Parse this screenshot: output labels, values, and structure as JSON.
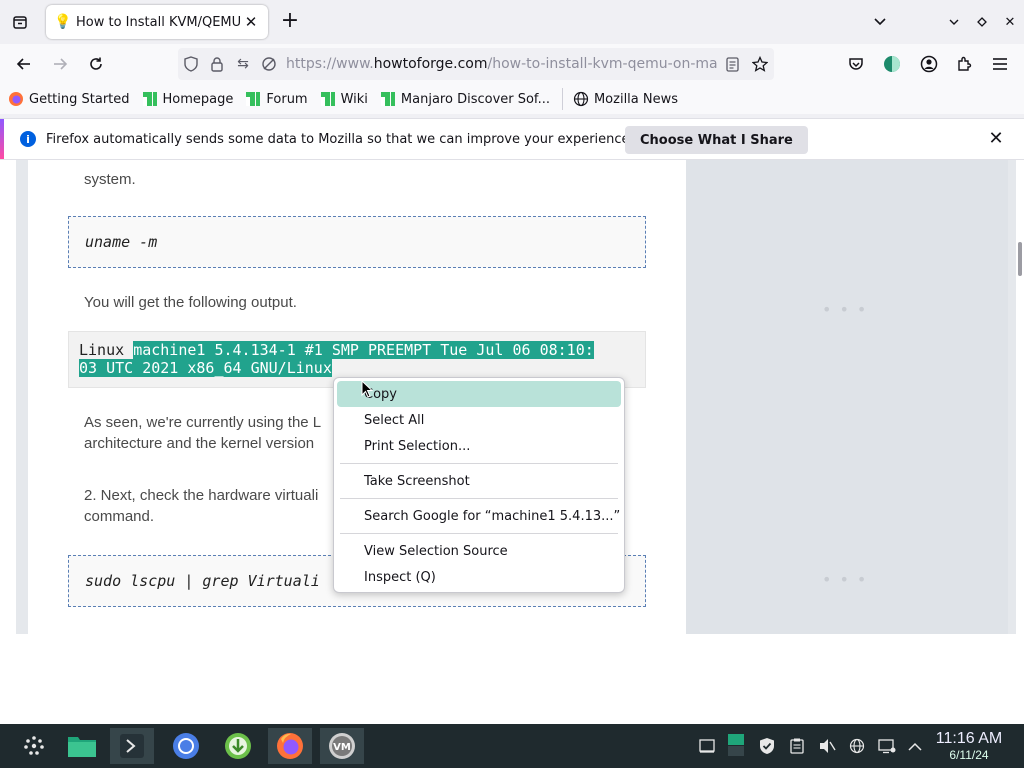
{
  "tab": {
    "title": "How to Install KVM/QEMU",
    "favicon": "lightbulb-icon"
  },
  "url": {
    "prefix": "https://www.",
    "host": "howtoforge.com",
    "path": "/how-to-install-kvm-qemu-on-manj"
  },
  "bookmarks": [
    {
      "label": "Getting Started",
      "icon": "firefox-icon"
    },
    {
      "label": "Homepage",
      "icon": "manjaro-icon"
    },
    {
      "label": "Forum",
      "icon": "manjaro-icon"
    },
    {
      "label": "Wiki",
      "icon": "manjaro-icon"
    },
    {
      "label": "Manjaro Discover Sof...",
      "icon": "manjaro-icon"
    },
    {
      "label": "Mozilla News",
      "icon": "globe-icon"
    }
  ],
  "notice": {
    "message": "Firefox automatically sends some data to Mozilla so that we can improve your experience.",
    "button": "Choose What I Share"
  },
  "article": {
    "para_top": "system.",
    "cmd1": "uname -m",
    "para_output": "You will get the following output.",
    "output_plain": "Linux ",
    "output_selected_line1": "machine1 5.4.134-1 #1 SMP PREEMPT Tue Jul 06 08:10:",
    "output_selected_line2": "03 UTC 2021 x86_64 GNU/Linux",
    "para_seen_1": "As seen, we're currently using the L",
    "para_seen_2": "architecture and the kernel version",
    "para_next_1": "2. Next, check the hardware virtuali",
    "para_next_2": "command.",
    "cmd2": "sudo lscpu | grep Virtuali"
  },
  "context_menu": {
    "copy": "Copy",
    "select_all": "Select All",
    "print_selection": "Print Selection...",
    "take_screenshot": "Take Screenshot",
    "search_google": "Search Google for “machine1 5.4.13...”",
    "view_selection_source": "View Selection Source",
    "inspect": "Inspect (Q)"
  },
  "clock": {
    "time": "11:16 AM",
    "date": "6/11/24"
  },
  "colors": {
    "selection": "#21a38d",
    "menu_highlight": "#b9e2d9",
    "taskbar": "#1f2a2e",
    "manjaro_green": "#35bf5c"
  }
}
